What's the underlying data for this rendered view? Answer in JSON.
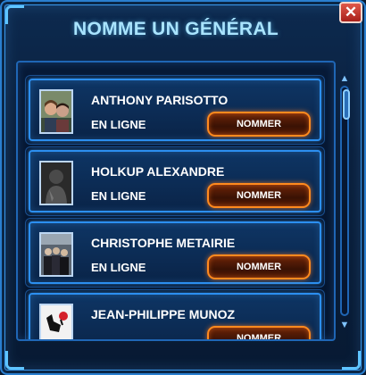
{
  "dialog": {
    "title": "NOMME UN GÉNÉRAL",
    "close_label": "✕"
  },
  "candidates": [
    {
      "name": "ANTHONY PARISOTTO",
      "status": "EN LIGNE",
      "action_label": "NOMMER",
      "avatar_icon": "two-people-photo"
    },
    {
      "name": "HOLKUP ALEXANDRE",
      "status": "EN LIGNE",
      "action_label": "NOMMER",
      "avatar_icon": "dark-figure-photo"
    },
    {
      "name": "CHRISTOPHE METAIRIE",
      "status": "EN LIGNE",
      "action_label": "NOMMER",
      "avatar_icon": "group-photo"
    },
    {
      "name": "JEAN-PHILIPPE MUNOZ",
      "status": "",
      "action_label": "NOMMER",
      "avatar_icon": "graffiti-photo"
    }
  ],
  "colors": {
    "accent_blue": "#2c8ff0",
    "title_text": "#a9e4ff",
    "button_orange": "#ff8a1e",
    "close_red": "#c0392b"
  }
}
